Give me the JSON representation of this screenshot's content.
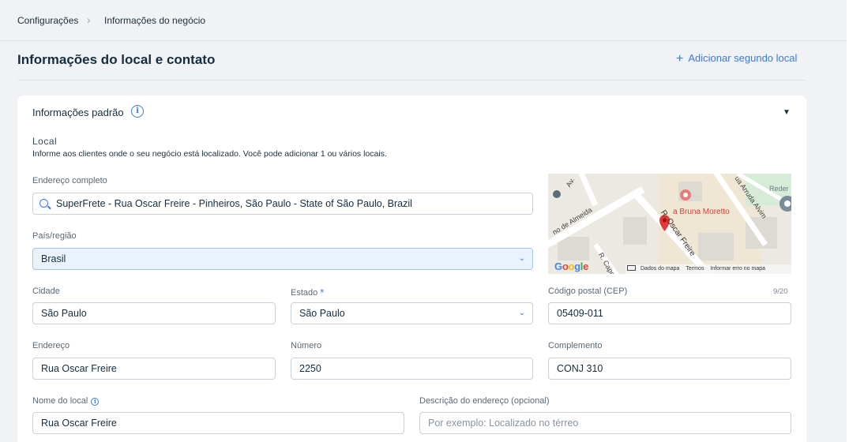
{
  "breadcrumb": [
    "Configurações",
    "Informações do negócio"
  ],
  "page_title": "Informações do local e contato",
  "add_location_label": "Adicionar segundo local",
  "section": {
    "title": "Informações padrão",
    "local_label": "Local",
    "local_desc": "Informe aos clientes onde o seu negócio está localizado. Você pode adicionar 1 ou vários locais."
  },
  "fields": {
    "full_address": {
      "label": "Endereço completo",
      "value": "SuperFrete - Rua Oscar Freire - Pinheiros, São Paulo - State of São Paulo, Brazil"
    },
    "country": {
      "label": "País/região",
      "value": "Brasil"
    },
    "city": {
      "label": "Cidade",
      "value": "São Paulo"
    },
    "state": {
      "label": "Estado",
      "required_mark": "*",
      "value": "São Paulo"
    },
    "postal": {
      "label": "Código postal (CEP)",
      "value": "05409-011",
      "counter": "9/20"
    },
    "street": {
      "label": "Endereço",
      "value": "Rua Oscar Freire"
    },
    "number": {
      "label": "Número",
      "value": "2250"
    },
    "complement": {
      "label": "Complemento",
      "value": "CONJ 310"
    },
    "location_name": {
      "label": "Nome do local",
      "value": "Rua Oscar Freire"
    },
    "address_desc": {
      "label": "Descrição do endereço (opcional)",
      "placeholder": "Por exemplo: Localizado no térreo"
    }
  },
  "map": {
    "street_labels": [
      "Av.",
      "no de Almeida",
      "R. Oscar Freire",
      "R. Capo",
      "ua Arruda Alvim"
    ],
    "place_label": "a Bruna Moretto",
    "rede_label": "Reder",
    "footer": [
      "Dados do mapa",
      "Termos",
      "Informar erro no mapa"
    ],
    "google_letters": [
      "G",
      "o",
      "o",
      "g",
      "l",
      "e"
    ],
    "google_colors": [
      "#4285f4",
      "#ea4335",
      "#fbbc05",
      "#4285f4",
      "#34a853",
      "#ea4335"
    ],
    "marker_color": "#e53935"
  },
  "icons": {
    "breadcrumb_separator": "chevron-right-icon",
    "add": "plus-icon",
    "info": "info-icon",
    "collapse": "caret-down-icon",
    "search": "search-icon",
    "dropdown": "chevron-down-icon"
  },
  "colors": {
    "accent": "#3b7ad9",
    "selected_bg": "#eaf2fd",
    "page_bg": "#f0f2f5"
  }
}
